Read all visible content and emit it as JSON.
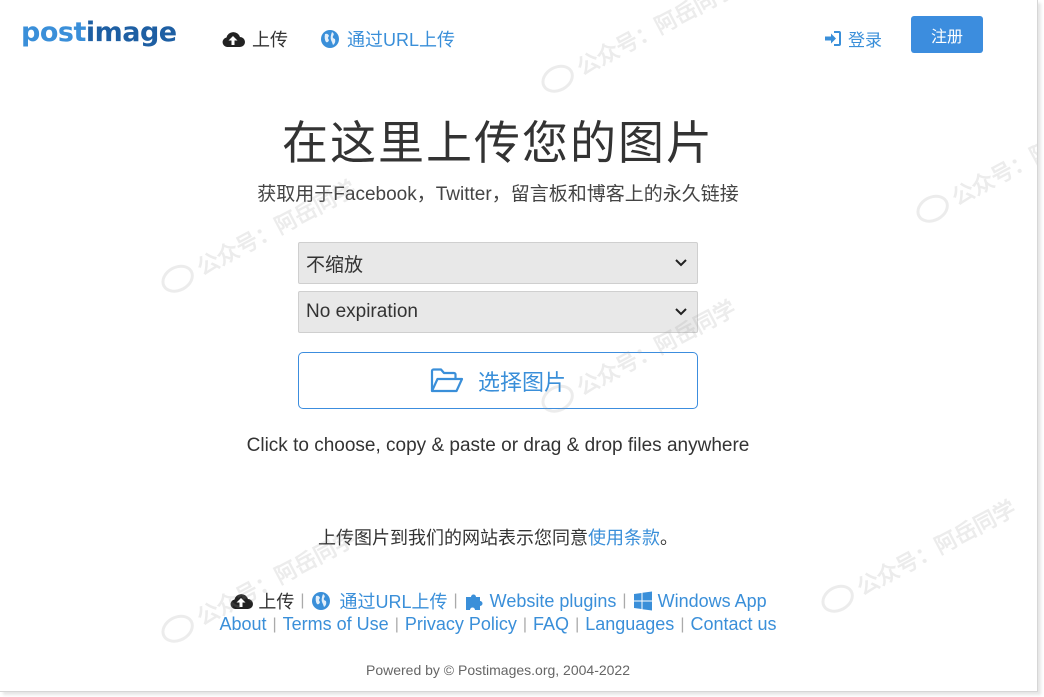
{
  "brand": {
    "logo_part1": "post",
    "logo_part2": "image"
  },
  "nav": {
    "upload_label": "上传",
    "upload_url_label": "通过URL上传",
    "login_label": "登录",
    "register_label": "注册"
  },
  "hero": {
    "title": "在这里上传您的图片",
    "subtitle": "获取用于Facebook，Twitter，留言板和博客上的永久链接"
  },
  "form": {
    "resize_selected": "不缩放",
    "expiration_selected": "No expiration",
    "choose_button_label": "选择图片",
    "hint": "Click to choose, copy & paste or drag & drop files anywhere"
  },
  "terms": {
    "prefix": "上传图片到我们的网站表示您同意",
    "link": "使用条款",
    "suffix": "。"
  },
  "footer": {
    "row1": {
      "upload": "上传",
      "upload_url": "通过URL上传",
      "plugins": "Website plugins",
      "windows_app": "Windows App"
    },
    "row2": [
      "About",
      "Terms of Use",
      "Privacy Policy",
      "FAQ",
      "Languages",
      "Contact us"
    ],
    "powered": "Powered by © Postimages.org, 2004-2022"
  },
  "watermark": {
    "text": "公众号：阿岳同学"
  },
  "colors": {
    "accent": "#3a8fd9",
    "button_bg": "#3c8dde",
    "select_bg": "#e8e8e8"
  },
  "icons": [
    "cloud-upload-icon",
    "globe-icon",
    "sign-in-icon",
    "folder-open-icon",
    "puzzle-icon",
    "windows-icon",
    "chevron-down-icon"
  ]
}
